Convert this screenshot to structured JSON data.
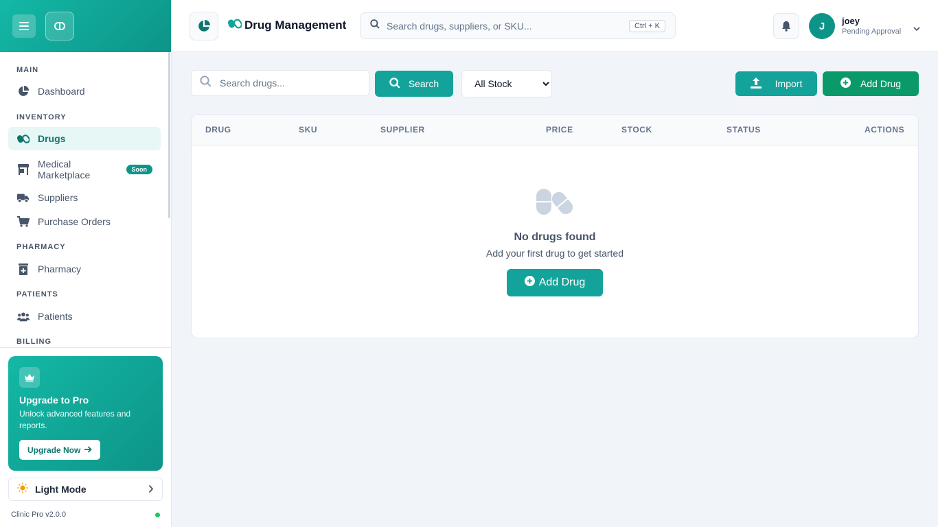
{
  "sidebar": {
    "sections": {
      "main": "MAIN",
      "inventory": "INVENTORY",
      "pharmacy": "PHARMACY",
      "patients": "PATIENTS",
      "billing": "BILLING"
    },
    "items": {
      "dashboard": "Dashboard",
      "drugs": "Drugs",
      "marketplace": "Medical Marketplace",
      "marketplace_badge": "Soon",
      "suppliers": "Suppliers",
      "purchase_orders": "Purchase Orders",
      "pharmacy": "Pharmacy",
      "patients": "Patients"
    },
    "upgrade": {
      "title": "Upgrade to Pro",
      "description": "Unlock advanced features and reports.",
      "button": "Upgrade Now"
    },
    "theme_toggle": "Light Mode",
    "version": "Clinic Pro v2.0.0"
  },
  "header": {
    "title": "Drug Management",
    "search_placeholder": "Search drugs, suppliers, or SKU...",
    "shortcut": "Ctrl + K",
    "user": {
      "initial": "J",
      "name": "joey",
      "status": "Pending Approval"
    }
  },
  "toolbar": {
    "search_placeholder": "Search drugs...",
    "search_button": "Search",
    "stock_filter": {
      "selected": "All Stock",
      "options": [
        "All Stock"
      ]
    },
    "import_button": "Import",
    "add_button": "Add Drug"
  },
  "table": {
    "columns": [
      "DRUG",
      "SKU",
      "SUPPLIER",
      "PRICE",
      "STOCK",
      "STATUS",
      "ACTIONS"
    ],
    "empty_title": "No drugs found",
    "empty_subtitle": "Add your first drug to get started",
    "empty_button": "Add Drug"
  },
  "colors": {
    "primary": "#14a39a",
    "primary_dark": "#0d9488",
    "add_green": "#0a9a6a",
    "online": "#22c55e"
  }
}
